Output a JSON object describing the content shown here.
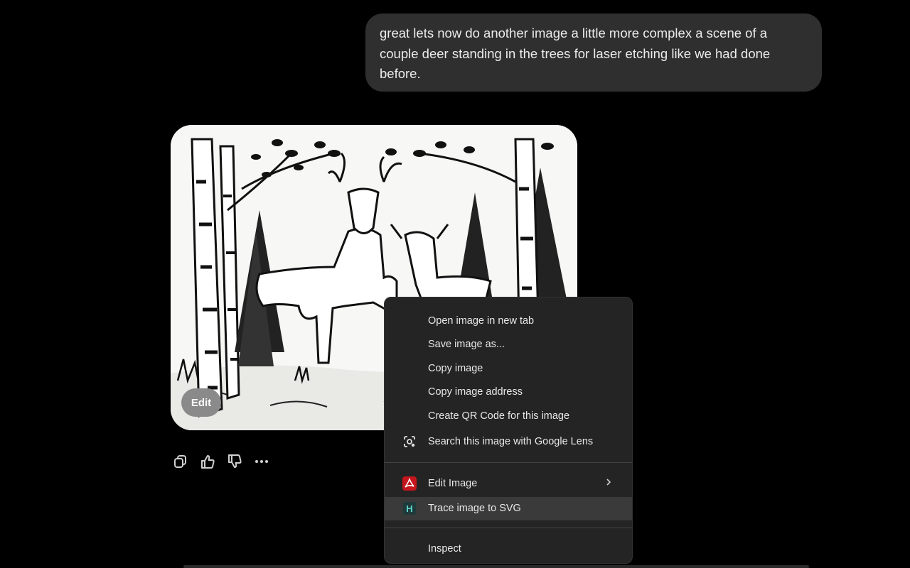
{
  "conversation": {
    "user_message": "great lets now do another image a little more complex a scene of a couple deer standing in the trees for laser etching like we had done before.",
    "image_edit_label": "Edit"
  },
  "message_actions": {
    "icons": [
      "copy-icon",
      "thumbs-up-icon",
      "thumbs-down-icon",
      "more-options-icon"
    ]
  },
  "context_menu": {
    "items": [
      {
        "label": "Open image in new tab"
      },
      {
        "label": "Save image as..."
      },
      {
        "label": "Copy image"
      },
      {
        "label": "Copy image address"
      },
      {
        "label": "Create QR Code for this image"
      },
      {
        "label": "Search this image with Google Lens",
        "icon": "google-lens-icon"
      },
      {
        "label": "Edit Image",
        "icon": "acrobat-icon",
        "submenu": true
      },
      {
        "label": "Trace image to SVG",
        "icon": "h-extension-icon",
        "highlighted": true
      },
      {
        "label": "Inspect"
      }
    ]
  },
  "colors": {
    "background": "#000000",
    "bubble": "#2f2f2f",
    "menu": "#242424",
    "menu_highlight": "#3a3a3a",
    "acrobat_red": "#c4161c",
    "h_teal": "#1f8f8a"
  }
}
